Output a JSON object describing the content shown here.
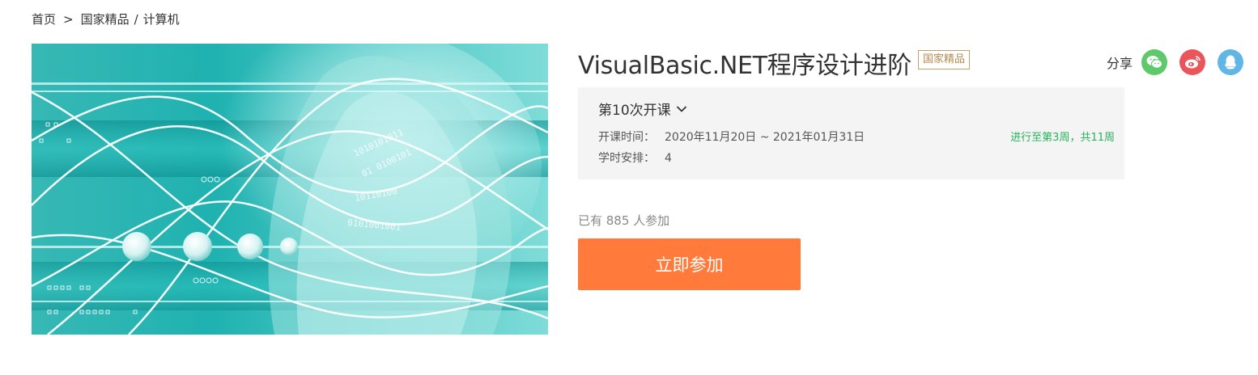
{
  "breadcrumb": {
    "home": "首页",
    "separator": ">",
    "category": "国家精品",
    "slash": "/",
    "subcategory": "计算机"
  },
  "cover": {
    "image_label": "course-cover-image",
    "binary_texts": [
      "1010101011",
      "01 0100101",
      "10110100",
      "0101001001"
    ]
  },
  "course": {
    "title": "VisualBasic.NET程序设计进阶",
    "badge": "国家精品"
  },
  "share": {
    "label": "分享",
    "icons": [
      "wechat-icon",
      "weibo-icon",
      "qq-icon"
    ]
  },
  "term": {
    "selected": "第10次开课",
    "time_label": "开课时间：",
    "time_value": "2020年11月20日 ~ 2021年01月31日",
    "hours_label": "学时安排：",
    "hours_value": "4",
    "progress": "进行至第3周，共11周"
  },
  "enroll": {
    "count_text": "已有 885 人参加",
    "button": "立即参加"
  },
  "colors": {
    "accent_orange": "#ff7a3b",
    "progress_green": "#25b35a",
    "badge_gold": "#b38a52"
  }
}
